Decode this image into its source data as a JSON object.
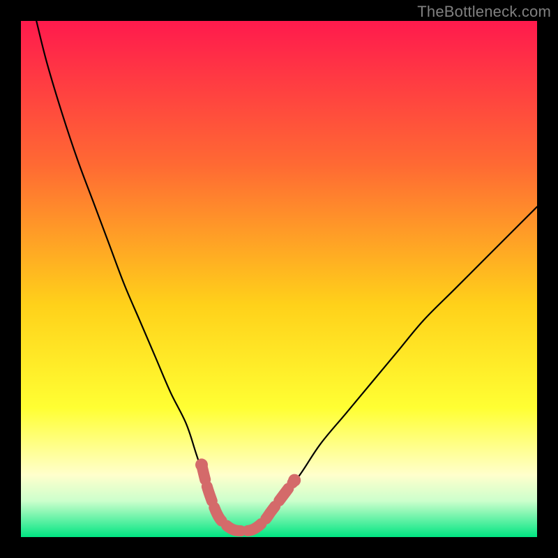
{
  "watermark": "TheBottleneck.com",
  "colors": {
    "page_bg": "#000000",
    "grad_top": "#ff1a4d",
    "grad_mid1": "#ff6a33",
    "grad_mid2": "#ffd11a",
    "grad_mid3": "#ffff33",
    "grad_low1": "#ffffcc",
    "grad_low2": "#ccffcc",
    "grad_bottom": "#00e582",
    "curve": "#000000",
    "marker": "#d46a6a"
  },
  "chart_data": {
    "type": "line",
    "title": "",
    "xlabel": "",
    "ylabel": "",
    "xlim": [
      0,
      100
    ],
    "ylim": [
      0,
      100
    ],
    "series": [
      {
        "name": "bottleneck-curve-left",
        "x": [
          3,
          5,
          8,
          11,
          14,
          17,
          20,
          23,
          26,
          29,
          32,
          34,
          36,
          37.5,
          39
        ],
        "y": [
          100,
          92,
          82,
          73,
          65,
          57,
          49,
          42,
          35,
          28,
          22,
          16,
          10,
          6,
          3
        ]
      },
      {
        "name": "bottleneck-curve-bottom",
        "x": [
          39,
          41,
          43,
          45,
          47
        ],
        "y": [
          3,
          1.5,
          1.2,
          1.5,
          3
        ]
      },
      {
        "name": "bottleneck-curve-right",
        "x": [
          47,
          50,
          54,
          58,
          63,
          68,
          73,
          78,
          84,
          90,
          96,
          100
        ],
        "y": [
          3,
          7,
          12,
          18,
          24,
          30,
          36,
          42,
          48,
          54,
          60,
          64
        ]
      }
    ],
    "markers": [
      {
        "name": "highlight-segment-left",
        "x": [
          35,
          36,
          37,
          38,
          39
        ],
        "y": [
          14,
          10,
          7,
          4.5,
          3
        ]
      },
      {
        "name": "highlight-segment-bottom",
        "x": [
          39,
          41,
          43,
          45,
          47
        ],
        "y": [
          3,
          1.5,
          1.2,
          1.5,
          3
        ]
      },
      {
        "name": "highlight-segment-right",
        "x": [
          47,
          48.5,
          50,
          51.5,
          53
        ],
        "y": [
          3,
          5,
          7,
          9,
          11
        ]
      }
    ],
    "gradient_stops": [
      {
        "offset": 0.0,
        "key": "grad_top"
      },
      {
        "offset": 0.28,
        "key": "grad_mid1"
      },
      {
        "offset": 0.55,
        "key": "grad_mid2"
      },
      {
        "offset": 0.75,
        "key": "grad_mid3"
      },
      {
        "offset": 0.88,
        "key": "grad_low1"
      },
      {
        "offset": 0.93,
        "key": "grad_low2"
      },
      {
        "offset": 1.0,
        "key": "grad_bottom"
      }
    ]
  }
}
